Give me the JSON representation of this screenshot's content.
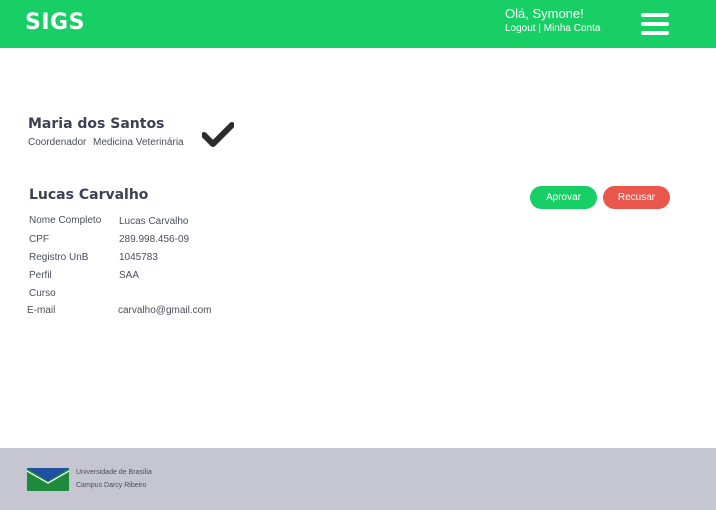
{
  "header": {
    "app_name": "SIGS",
    "greeting": "Olá, Symone!",
    "logout": "Logout",
    "separator": " | ",
    "account": "Minha Conta"
  },
  "current_user": {
    "name": "Maria dos Santos",
    "role": "Coordenador",
    "course": "Medicina Veterinária"
  },
  "request": {
    "name": "Lucas Carvalho",
    "approve_label": "Aprovar",
    "refuse_label": "Recusar",
    "fields": [
      {
        "label": "Nome Completo",
        "value": "Lucas Carvalho"
      },
      {
        "label": "CPF",
        "value": "289.998.456-09"
      },
      {
        "label": "Registro UnB",
        "value": "1045783"
      },
      {
        "label": "Perfil",
        "value": "SAA"
      },
      {
        "label": "Curso",
        "value": ""
      },
      {
        "label": "E-mail",
        "value": "carvalho@gmail.com"
      }
    ]
  },
  "footer": {
    "university": "Universidade de Brasília",
    "campus": "Campus Darcy Ribeiro"
  },
  "colors": {
    "primary_green": "#17cf65",
    "refuse_red": "#e9564b",
    "footer_bg": "#c6c6d2"
  },
  "icons": {
    "menu": "hamburger-menu-icon",
    "confirmed": "checkmark-icon",
    "university_logo": "unb-logo-icon"
  }
}
